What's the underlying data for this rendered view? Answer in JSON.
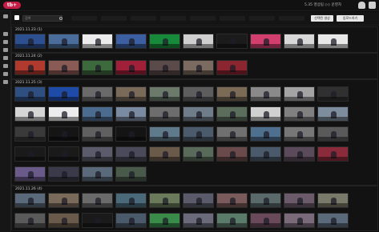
{
  "app": {
    "logo_text": "tb+",
    "brand_color": "#c51d47",
    "user_info": "5.35 영상팀 ◇◇ 운영자",
    "icons": [
      "cloud-icon",
      "logout-icon"
    ]
  },
  "sidebar": {
    "icons": [
      "star-icon",
      "image-icon",
      "video-icon",
      "folder-icon",
      "calendar-icon",
      "edit-icon",
      "list-icon",
      "trash-icon"
    ]
  },
  "toolbar": {
    "search_placeholder": "검색",
    "filters": [
      "",
      "",
      "",
      "",
      "",
      "",
      "",
      ""
    ],
    "select_all_label": "선택된 영상",
    "upload_label": "업로드하기"
  },
  "sections": [
    {
      "title": "2021.11.23 (1)",
      "thumbs": [
        "#2c4f8f",
        "#4a6d9c",
        "#ececec",
        "#3b5fa0",
        "#168a3a",
        "#cfcfcf",
        "#1b1b1b",
        "#d23f6f",
        "#d8d8d8",
        "#e8e8e8"
      ]
    },
    {
      "title": "2021.11.24 (2)",
      "thumbs": [
        "#b03a2e",
        "#8a5a54",
        "#3d6a3c",
        "#a0203a",
        "#5b4a4a",
        "#7a6a60",
        "#8b2630"
      ]
    },
    {
      "title": "2021.11.25 (3)",
      "rows": [
        [
          "#2e4f80",
          "#1f4ba8",
          "#6a6a6a",
          "#7a6a5a",
          "#6b7a6b",
          "#5d5d5d",
          "#7b6b56",
          "#8a8a8a",
          "#a4a4a4",
          "#303030"
        ],
        [
          "#d6d6d6",
          "#ededed",
          "#4b6b8f",
          "#7a8aa0",
          "#6d6d6d",
          "#6f7d8a",
          "#5b6d5b",
          "#d0d0d0",
          "#808080",
          "#7d8d9d"
        ],
        [
          "#3a3a3a",
          "#151515",
          "#606060",
          "#141414",
          "#5f7a8a",
          "#4b5b6b",
          "#707070",
          "#4f6f8f",
          "#777777",
          "#5a5a5a"
        ],
        [
          "#1a1a1a",
          "#1a1a1a",
          "#5b5b6b",
          "#4a4a5a",
          "#6a5a4a",
          "#5a6a5a",
          "#6a4a4a",
          "#4a5a6a",
          "#5a4a5a",
          "#8a2a3a"
        ],
        [
          "#6a5a8a",
          "#3a3a4a",
          "#5a6a7a",
          "#4a5a4a"
        ]
      ]
    },
    {
      "title": "2021.11.26 (4)",
      "rows": [
        [
          "#5a6a7a",
          "#7a6a5a",
          "#6a6a6a",
          "#4a6a7a",
          "#6a7a5a",
          "#5a5a6a",
          "#7a5a5a",
          "#5a6a6a",
          "#6a5a6a",
          "#7a7a6a"
        ],
        [
          "#5a5a5a",
          "#6a5a4a",
          "#1a1a1a",
          "#4a5a6a",
          "#3a8a4a",
          "#6a6a7a",
          "#5a7a6a",
          "#6a4a5a",
          "#7a6a7a",
          "#5a6a7a"
        ]
      ]
    }
  ]
}
